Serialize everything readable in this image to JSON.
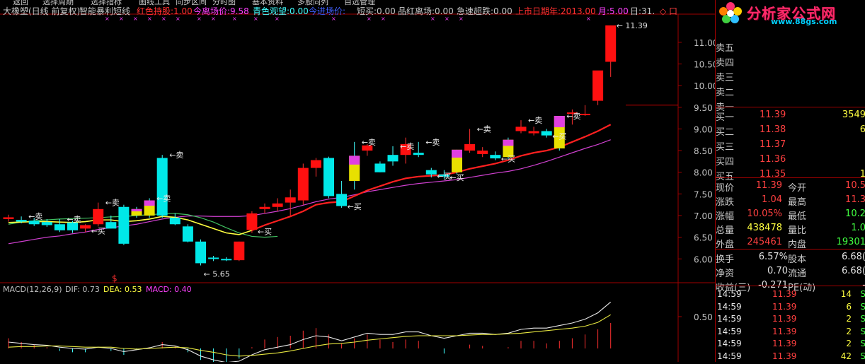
{
  "menu": [
    "返回",
    "选择周期",
    "选择指标",
    "画线工具",
    "同步区间",
    "分时图",
    "基本资料",
    "多股同列",
    "自选管理"
  ],
  "header": {
    "stock_name": "大橡塑",
    "period": "(日线 前复权)",
    "indicator_name": "智能暴利短线",
    "items": [
      {
        "label": "红色持股:",
        "value": "1.00",
        "color": "#ff3030"
      },
      {
        "label": "今离场价:",
        "value": "9.58",
        "color": "#ff40ff"
      },
      {
        "label": "青色观望:",
        "value": "0.00",
        "color": "#40ffff"
      },
      {
        "label": "今进场价:",
        "value": "",
        "color": "#4060ff"
      },
      {
        "label": "短买:",
        "value": "0.00",
        "color": "#c8c8c8"
      },
      {
        "label": "品红离场:",
        "value": "0.00",
        "color": "#c8c8c8"
      },
      {
        "label": "急速超跌:",
        "value": "0.00",
        "color": "#c8c8c8"
      },
      {
        "label": "上市日期年:",
        "value": "2013.00",
        "color": "#ff3030"
      },
      {
        "label": "月:",
        "value": "5.00",
        "color": "#ff40ff"
      },
      {
        "label": "日:",
        "value": "31.",
        "color": "#c8c8c8"
      }
    ],
    "window_icons": "◇ 口"
  },
  "price_axis": {
    "labels": [
      "11.00",
      "10.50",
      "10.00",
      "9.50",
      "9.00",
      "8.50",
      "8.00",
      "7.50",
      "7.00",
      "6.50",
      "6.00"
    ],
    "values": [
      11.0,
      10.5,
      10.0,
      9.5,
      9.0,
      8.5,
      8.0,
      7.5,
      7.0,
      6.5,
      6.0
    ],
    "range": [
      5.45,
      11.65
    ]
  },
  "annotations": {
    "high": "11.39",
    "low": "5.65",
    "sell": "←卖",
    "buy": "←买",
    "buy_short": "买",
    "dollar": "$"
  },
  "macd": {
    "title": "MACD(12,26,9)",
    "dif_label": "DIF: 0.73",
    "dea_label": "DEA: 0.53",
    "macd_label": "MACD: 0.40",
    "axis_label": "0.50"
  },
  "order_book": {
    "asks": [
      {
        "label": "卖五",
        "price": "",
        "vol": ""
      },
      {
        "label": "卖四",
        "price": "",
        "vol": ""
      },
      {
        "label": "卖三",
        "price": "",
        "vol": ""
      },
      {
        "label": "卖二",
        "price": "",
        "vol": ""
      },
      {
        "label": "卖一",
        "price": "",
        "vol": ""
      }
    ],
    "bids": [
      {
        "label": "买一",
        "price": "11.39",
        "vol": "3549"
      },
      {
        "label": "买二",
        "price": "11.38",
        "vol": "6"
      },
      {
        "label": "买三",
        "price": "11.37",
        "vol": ""
      },
      {
        "label": "买四",
        "price": "11.36",
        "vol": ""
      },
      {
        "label": "买五",
        "price": "11.35",
        "vol": "1"
      }
    ]
  },
  "quote": [
    {
      "l1": "现价",
      "v1": "11.39",
      "c1": "#ff4040",
      "l2": "今开",
      "v2": "10.5",
      "c2": "#ff4040"
    },
    {
      "l1": "涨跌",
      "v1": "1.04",
      "c1": "#ff4040",
      "l2": "最高",
      "v2": "11.3",
      "c2": "#ff4040"
    },
    {
      "l1": "涨幅",
      "v1": "10.05%",
      "c1": "#ff4040",
      "l2": "最低",
      "v2": "10.2",
      "c2": "#40ff40"
    },
    {
      "l1": "总量",
      "v1": "438478",
      "c1": "#ffff40",
      "l2": "量比",
      "v2": "1.0",
      "c2": "#40ff40"
    },
    {
      "l1": "外盘",
      "v1": "245461",
      "c1": "#ff4040",
      "l2": "内盘",
      "v2": "19301",
      "c2": "#40ff40"
    }
  ],
  "fundamentals": [
    {
      "l1": "换手",
      "v1": "6.57%",
      "l2": "股本",
      "v2": "6.68("
    },
    {
      "l1": "净资",
      "v1": "0.70",
      "l2": "流通",
      "v2": "6.68("
    },
    {
      "l1": "收益(三)",
      "v1": "-0.271",
      "l2": "PE(动)",
      "v2": "-"
    }
  ],
  "trades": [
    {
      "time": "14:59",
      "price": "11.39",
      "vol": "14",
      "flag": "S"
    },
    {
      "time": "14:59",
      "price": "11.39",
      "vol": "6",
      "flag": "S"
    },
    {
      "time": "14:59",
      "price": "11.39",
      "vol": "2",
      "flag": "S"
    },
    {
      "time": "14:59",
      "price": "11.39",
      "vol": "2",
      "flag": "S"
    },
    {
      "time": "14:59",
      "price": "11.39",
      "vol": "2",
      "flag": "S"
    },
    {
      "time": "14:59",
      "price": "11.39",
      "vol": "42",
      "flag": "S"
    }
  ],
  "logo": {
    "brand": "分析家公式网",
    "url": "www.88gs.com"
  },
  "chart_data": {
    "type": "candlestick",
    "candles": [
      {
        "o": 6.92,
        "h": 7.02,
        "l": 6.86,
        "c": 6.96,
        "s": "r"
      },
      {
        "o": 6.9,
        "h": 6.98,
        "l": 6.82,
        "c": 6.86,
        "s": "c"
      },
      {
        "o": 6.88,
        "h": 6.95,
        "l": 6.76,
        "c": 6.8,
        "s": "c"
      },
      {
        "o": 6.85,
        "h": 6.92,
        "l": 6.74,
        "c": 6.78,
        "s": "c"
      },
      {
        "o": 6.8,
        "h": 6.92,
        "l": 6.62,
        "c": 6.66,
        "s": "c"
      },
      {
        "o": 6.66,
        "h": 6.88,
        "l": 6.6,
        "c": 6.84,
        "s": "c"
      },
      {
        "o": 6.7,
        "h": 6.8,
        "l": 6.62,
        "c": 6.78,
        "s": "r"
      },
      {
        "o": 6.8,
        "h": 7.3,
        "l": 6.75,
        "c": 7.15,
        "s": "r"
      },
      {
        "o": 6.85,
        "h": 7.0,
        "l": 6.7,
        "c": 6.7,
        "s": "c"
      },
      {
        "o": 7.2,
        "h": 7.25,
        "l": 6.32,
        "c": 6.35,
        "s": "c"
      },
      {
        "o": 7.0,
        "h": 7.2,
        "l": 6.95,
        "c": 7.15,
        "s": "y"
      },
      {
        "o": 7.0,
        "h": 7.4,
        "l": 6.95,
        "c": 7.35,
        "s": "y"
      },
      {
        "o": 8.33,
        "h": 8.4,
        "l": 6.95,
        "c": 7.0,
        "s": "c"
      },
      {
        "o": 6.95,
        "h": 7.05,
        "l": 6.78,
        "c": 6.8,
        "s": "c"
      },
      {
        "o": 6.75,
        "h": 6.8,
        "l": 6.38,
        "c": 6.4,
        "s": "c"
      },
      {
        "o": 6.4,
        "h": 6.45,
        "l": 5.85,
        "c": 5.9,
        "s": "c"
      },
      {
        "o": 6.03,
        "h": 6.07,
        "l": 5.95,
        "c": 6.0,
        "s": "c"
      },
      {
        "o": 6.0,
        "h": 6.04,
        "l": 5.95,
        "c": 5.97,
        "s": "c"
      },
      {
        "o": 5.97,
        "h": 6.4,
        "l": 5.95,
        "c": 6.4,
        "s": "r"
      },
      {
        "o": 6.67,
        "h": 7.1,
        "l": 6.6,
        "c": 7.05,
        "s": "r"
      },
      {
        "o": 7.15,
        "h": 7.28,
        "l": 7.05,
        "c": 7.2,
        "s": "r"
      },
      {
        "o": 7.2,
        "h": 7.4,
        "l": 7.1,
        "c": 7.28,
        "s": "r"
      },
      {
        "o": 7.3,
        "h": 7.6,
        "l": 7.0,
        "c": 7.42,
        "s": "r"
      },
      {
        "o": 7.35,
        "h": 8.2,
        "l": 7.25,
        "c": 8.1,
        "s": "r"
      },
      {
        "o": 8.1,
        "h": 8.33,
        "l": 7.9,
        "c": 8.28,
        "s": "r"
      },
      {
        "o": 8.33,
        "h": 8.36,
        "l": 7.4,
        "c": 7.45,
        "s": "c"
      },
      {
        "o": 7.5,
        "h": 7.8,
        "l": 7.18,
        "c": 7.22,
        "s": "c"
      },
      {
        "o": 7.8,
        "h": 8.7,
        "l": 7.6,
        "c": 8.38,
        "s": "y"
      },
      {
        "o": 8.5,
        "h": 8.65,
        "l": 8.38,
        "c": 8.62,
        "s": "r"
      },
      {
        "o": 8.2,
        "h": 8.25,
        "l": 8.0,
        "c": 8.0,
        "s": "c"
      },
      {
        "o": 8.4,
        "h": 8.6,
        "l": 8.15,
        "c": 8.25,
        "s": "c"
      },
      {
        "o": 8.4,
        "h": 8.8,
        "l": 8.2,
        "c": 8.65,
        "s": "r"
      },
      {
        "o": 8.45,
        "h": 8.7,
        "l": 8.35,
        "c": 8.4,
        "s": "c"
      },
      {
        "o": 8.05,
        "h": 8.1,
        "l": 7.88,
        "c": 7.95,
        "s": "c"
      },
      {
        "o": 7.95,
        "h": 8.05,
        "l": 7.85,
        "c": 7.9,
        "s": "c"
      },
      {
        "o": 8.0,
        "h": 8.52,
        "l": 7.95,
        "c": 8.52,
        "s": "y"
      },
      {
        "o": 8.5,
        "h": 9.0,
        "l": 8.45,
        "c": 8.65,
        "s": "r"
      },
      {
        "o": 8.5,
        "h": 8.58,
        "l": 8.35,
        "c": 8.42,
        "s": "r"
      },
      {
        "o": 8.4,
        "h": 8.48,
        "l": 8.28,
        "c": 8.32,
        "s": "c"
      },
      {
        "o": 8.35,
        "h": 8.8,
        "l": 8.3,
        "c": 8.75,
        "s": "y"
      },
      {
        "o": 9.05,
        "h": 9.2,
        "l": 8.9,
        "c": 8.95,
        "s": "r"
      },
      {
        "o": 8.95,
        "h": 9.05,
        "l": 8.85,
        "c": 8.9,
        "s": "r"
      },
      {
        "o": 8.95,
        "h": 9.0,
        "l": 8.8,
        "c": 8.85,
        "s": "c"
      },
      {
        "o": 8.55,
        "h": 9.3,
        "l": 8.5,
        "c": 9.3,
        "s": "y"
      },
      {
        "o": 9.35,
        "h": 9.45,
        "l": 9.1,
        "c": 9.38,
        "s": "r"
      },
      {
        "o": 9.35,
        "h": 9.55,
        "l": 9.3,
        "c": 9.35,
        "s": "r"
      },
      {
        "o": 9.65,
        "h": 10.3,
        "l": 9.55,
        "c": 10.35,
        "s": "r"
      },
      {
        "o": 10.55,
        "h": 11.39,
        "l": 10.2,
        "c": 11.39,
        "s": "r"
      }
    ],
    "ma_short": [
      6.84,
      6.85,
      6.86,
      6.86,
      6.85,
      6.84,
      6.86,
      6.9,
      6.9,
      6.86,
      6.88,
      6.92,
      6.98,
      6.96,
      6.9,
      6.8,
      6.7,
      6.6,
      6.56,
      6.66,
      6.78,
      6.88,
      6.98,
      7.1,
      7.25,
      7.3,
      7.32,
      7.45,
      7.58,
      7.68,
      7.78,
      7.86,
      7.9,
      7.92,
      7.94,
      8.0,
      8.08,
      8.14,
      8.2,
      8.28,
      8.38,
      8.45,
      8.5,
      8.58,
      8.7,
      8.82,
      8.95,
      9.1
    ],
    "ma_long": [
      6.35,
      6.4,
      6.45,
      6.5,
      6.53,
      6.58,
      6.62,
      6.68,
      6.72,
      6.76,
      6.8,
      6.86,
      6.92,
      6.96,
      6.99,
      6.99,
      6.98,
      6.98,
      6.98,
      7.0,
      7.05,
      7.1,
      7.16,
      7.24,
      7.32,
      7.38,
      7.42,
      7.48,
      7.55,
      7.6,
      7.65,
      7.7,
      7.74,
      7.77,
      7.8,
      7.83,
      7.88,
      7.93,
      7.98,
      8.02,
      8.08,
      8.16,
      8.25,
      8.35,
      8.45,
      8.55,
      8.64,
      8.75
    ],
    "ma_mid": [
      6.8,
      6.85,
      6.88,
      6.9,
      6.92,
      6.93,
      6.94,
      6.95,
      6.97,
      6.98,
      7.0,
      7.02,
      7.04,
      7.05,
      7.02,
      6.95,
      6.85,
      6.72,
      6.6,
      6.52,
      6.5,
      6.52
    ],
    "sell_signals": [
      1,
      4,
      7,
      11,
      12,
      27,
      30,
      32,
      36,
      40,
      43
    ],
    "buy_signals": [
      6,
      19,
      26,
      33,
      34,
      38,
      42
    ],
    "macd_dif": [
      0.1,
      0.08,
      0.06,
      0.05,
      0.02,
      0.0,
      -0.01,
      0.02,
      0.0,
      -0.05,
      -0.02,
      0.01,
      0.06,
      0.04,
      -0.02,
      -0.12,
      -0.18,
      -0.22,
      -0.2,
      -0.1,
      -0.02,
      0.02,
      0.06,
      0.14,
      0.2,
      0.18,
      0.12,
      0.18,
      0.24,
      0.22,
      0.22,
      0.26,
      0.26,
      0.2,
      0.16,
      0.2,
      0.24,
      0.24,
      0.22,
      0.24,
      0.3,
      0.32,
      0.32,
      0.36,
      0.4,
      0.46,
      0.56,
      0.73
    ],
    "macd_dea": [
      0.02,
      0.03,
      0.03,
      0.04,
      0.04,
      0.03,
      0.02,
      0.02,
      0.02,
      0.0,
      -0.01,
      0.0,
      0.01,
      0.02,
      0.01,
      -0.03,
      -0.06,
      -0.1,
      -0.12,
      -0.11,
      -0.09,
      -0.07,
      -0.04,
      0.0,
      0.04,
      0.07,
      0.08,
      0.1,
      0.13,
      0.15,
      0.17,
      0.19,
      0.2,
      0.2,
      0.2,
      0.2,
      0.21,
      0.22,
      0.22,
      0.23,
      0.24,
      0.26,
      0.28,
      0.3,
      0.32,
      0.35,
      0.41,
      0.53
    ],
    "macd_hist": [
      0.16,
      0.1,
      0.06,
      0.02,
      -0.04,
      -0.06,
      -0.06,
      0.0,
      -0.04,
      -0.1,
      -0.02,
      0.02,
      0.1,
      0.04,
      -0.06,
      -0.18,
      -0.24,
      -0.24,
      -0.16,
      0.02,
      0.14,
      0.18,
      0.2,
      0.28,
      0.32,
      0.22,
      0.08,
      0.16,
      0.22,
      0.14,
      0.1,
      0.14,
      0.12,
      0.0,
      -0.08,
      0.0,
      0.06,
      0.04,
      0.0,
      0.02,
      0.12,
      0.12,
      0.08,
      0.12,
      0.16,
      0.22,
      0.3,
      0.4
    ]
  }
}
